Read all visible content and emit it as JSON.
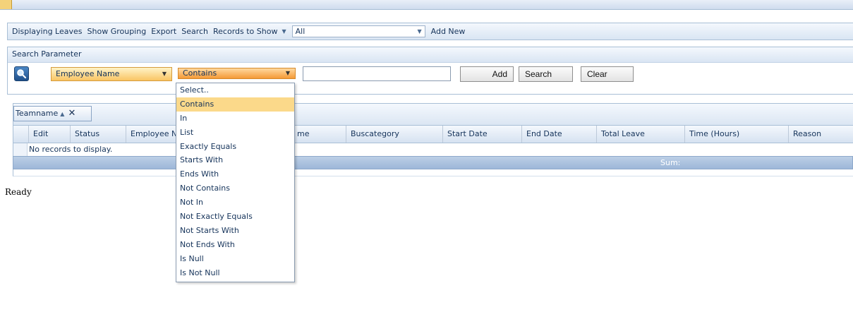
{
  "toolbar": {
    "displaying": "Displaying Leaves",
    "show_grouping": "Show Grouping",
    "export": "Export",
    "search": "Search",
    "records_to_show": "Records to Show",
    "records_value": "All",
    "add_new": "Add New"
  },
  "search_panel": {
    "header": "Search Parameter",
    "field_value": "Employee Name",
    "operator_value": "Contains",
    "text_value": "",
    "add_label": "Add",
    "search_label": "Search",
    "clear_label": "Clear"
  },
  "operator_options": [
    "Select..",
    "Contains",
    "In",
    "List",
    "Exactly Equals",
    "Starts With",
    "Ends With",
    "Not Contains",
    "Not In",
    "Not Exactly Equals",
    "Not Starts With",
    "Not Ends With",
    "Is Null",
    "Is Not Null"
  ],
  "selected_operator": "Contains",
  "grid": {
    "group_chip": "Teamname",
    "columns": [
      "Edit",
      "Status",
      "Employee N",
      "",
      "me",
      "Buscategory",
      "Start Date",
      "End Date",
      "Total Leave",
      "Time (Hours)",
      "Reason"
    ],
    "empty_text": "No records to display.",
    "footer_sum": "Sum:"
  },
  "status": "Ready",
  "colors": {
    "accent_orange": "#f59a36",
    "selected_item": "#fbd98a",
    "header_blue": "#d9e5f3"
  }
}
